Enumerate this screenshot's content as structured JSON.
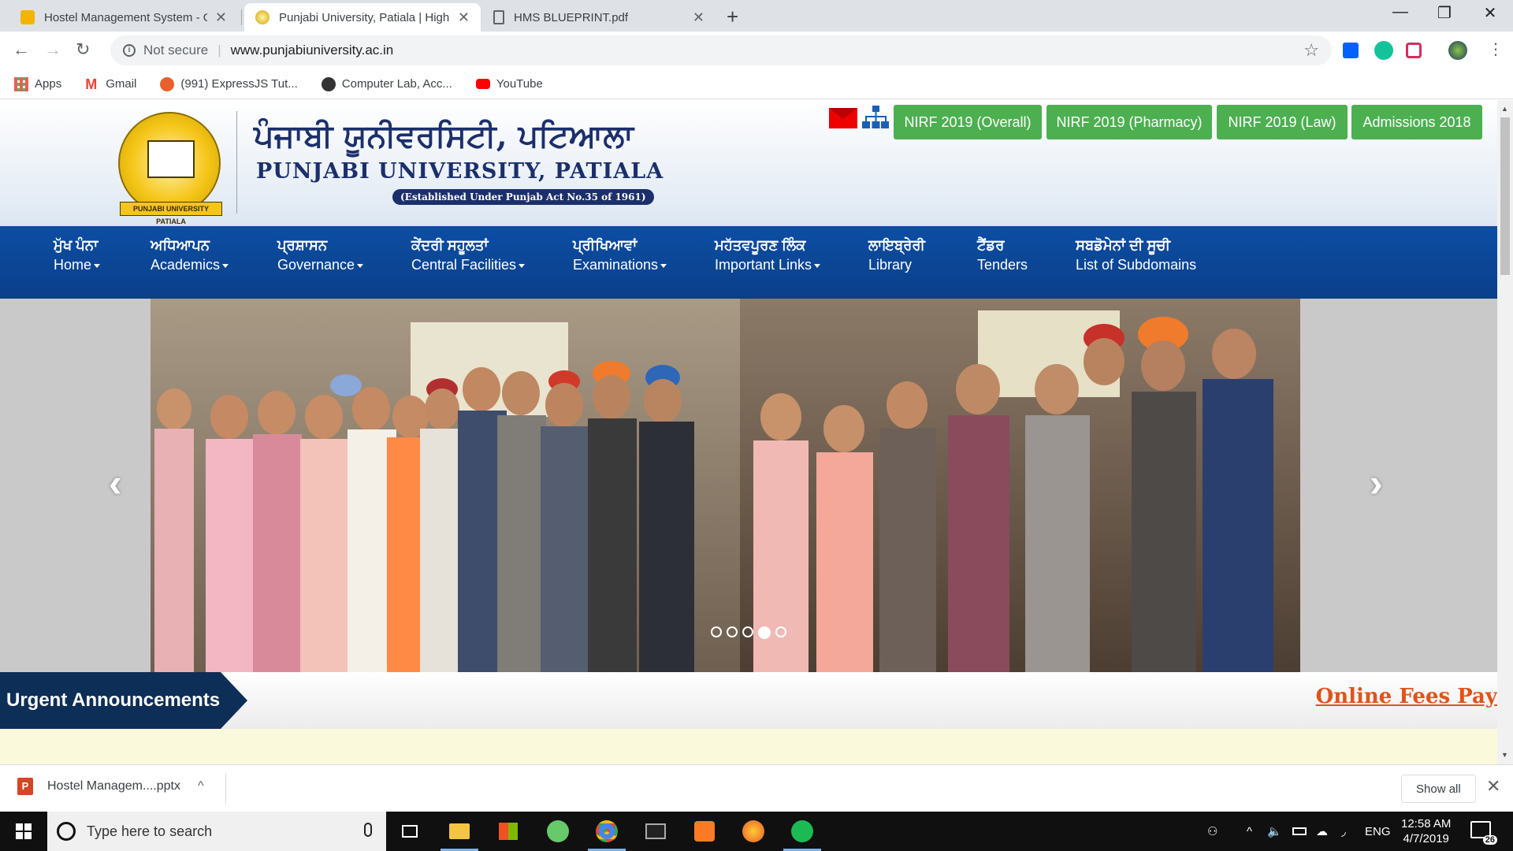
{
  "browser": {
    "tabs": [
      {
        "title": "Hostel Management System - Go",
        "active": false
      },
      {
        "title": "Punjabi University, Patiala | Highe",
        "active": true
      },
      {
        "title": "HMS BLUEPRINT.pdf",
        "active": false
      }
    ],
    "new_tab": "+",
    "window_controls": {
      "minimize": "—",
      "restore": "❐",
      "close": "✕"
    },
    "nav": {
      "back": "←",
      "forward": "→",
      "reload": "↻"
    },
    "security_label": "Not secure",
    "url": "www.punjabiuniversity.ac.in",
    "bookmark_star": "☆",
    "bookmarks": [
      {
        "label": "Apps",
        "icon": "apps-grid-icon"
      },
      {
        "label": "Gmail",
        "icon": "gmail-icon"
      },
      {
        "label": "(991) ExpressJS Tut...",
        "icon": "ask-icon"
      },
      {
        "label": "Computer Lab, Acc...",
        "icon": "computer-lab-icon"
      },
      {
        "label": "YouTube",
        "icon": "youtube-icon"
      }
    ]
  },
  "site": {
    "logo_ribbon": "PUNJABI UNIVERSITY PATIALA",
    "title_punjabi": "ਪੰਜਾਬੀ ਯੂਨੀਵਰਸਿਟੀ, ਪਟਿਆਲਾ",
    "title_english": "PUNJABI UNIVERSITY, PATIALA",
    "established": "(Established Under Punjab Act No.35 of 1961)",
    "top_buttons": [
      "NIRF 2019 (Overall)",
      "NIRF 2019 (Pharmacy)",
      "NIRF 2019 (Law)",
      "Admissions 2018"
    ],
    "nav": [
      {
        "pa": "ਮੁੱਖ ਪੰਨਾ",
        "en": "Home",
        "dropdown": true
      },
      {
        "pa": "ਅਧਿਆਪਨ",
        "en": "Academics",
        "dropdown": true
      },
      {
        "pa": "ਪ੍ਰਸ਼ਾਸਨ",
        "en": "Governance",
        "dropdown": true
      },
      {
        "pa": "ਕੇਂਦਰੀ ਸਹੂਲਤਾਂ",
        "en": "Central Facilities",
        "dropdown": true
      },
      {
        "pa": "ਪ੍ਰੀਖਿਆਵਾਂ",
        "en": "Examinations",
        "dropdown": true
      },
      {
        "pa": "ਮਹੱਤਵਪੂਰਣ ਲਿੰਕ",
        "en": "Important Links",
        "dropdown": true
      },
      {
        "pa": "ਲਾਇਬ੍ਰੇਰੀ",
        "en": "Library",
        "dropdown": false
      },
      {
        "pa": "ਟੈਂਡਰ",
        "en": "Tenders",
        "dropdown": false
      },
      {
        "pa": "ਸਬਡੋਮੇਨਾਂ ਦੀ ਸੂਚੀ",
        "en": "List of Subdomains",
        "dropdown": false
      }
    ],
    "slider": {
      "prev": "‹",
      "next": "›",
      "dot_count": 5,
      "active_dot": 4
    },
    "announcements_label": "Urgent Announcements",
    "fees_link": "Online Fees Pay"
  },
  "downloads": {
    "file": "Hostel Managem....pptx",
    "file_icon_letter": "P",
    "chevron": "^",
    "show_all": "Show all",
    "close": "✕"
  },
  "taskbar": {
    "search_placeholder": "Type here to search",
    "language": "ENG",
    "time": "12:58 AM",
    "date": "4/7/2019",
    "notifications": "26"
  },
  "colors": {
    "nav_blue": "#0d4ea3",
    "button_green": "#4cb050",
    "announce_navy": "#0d2e57",
    "fees_orange": "#e2521b"
  }
}
